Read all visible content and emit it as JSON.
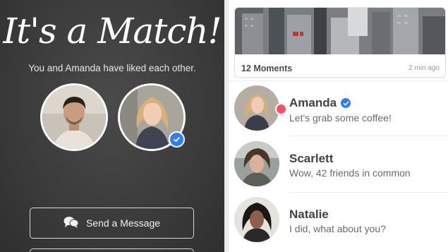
{
  "match_screen": {
    "title": "It's a Match!",
    "subtitle": "You and Amanda have liked each other.",
    "send_button_label": "Send a Message",
    "send_icon": "chat-bubbles-icon",
    "verified_icon": "verified-check-icon"
  },
  "moments": {
    "label": "12 Moments",
    "time": "2 min ago"
  },
  "conversations": [
    {
      "name": "Amanda",
      "message": "Let's grab some coffee!",
      "verified": true,
      "unread": true
    },
    {
      "name": "Scarlett",
      "message": "Wow, 42 friends in common",
      "verified": false,
      "unread": false
    },
    {
      "name": "Natalie",
      "message": "I did, what about you?",
      "verified": false,
      "unread": false
    }
  ],
  "colors": {
    "accent_red": "#fd5068",
    "verified_blue": "#2d7ff9",
    "panel_dark": "#3c3c3c"
  }
}
